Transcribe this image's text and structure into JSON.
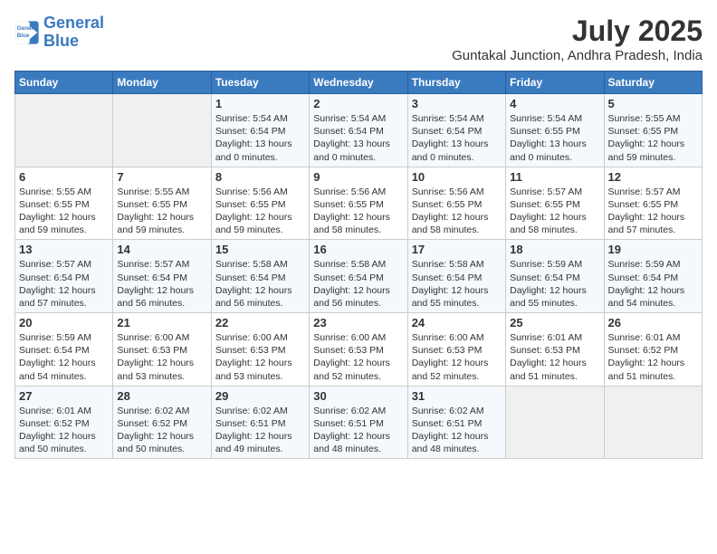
{
  "logo": {
    "line1": "General",
    "line2": "Blue"
  },
  "title": "July 2025",
  "subtitle": "Guntakal Junction, Andhra Pradesh, India",
  "days_of_week": [
    "Sunday",
    "Monday",
    "Tuesday",
    "Wednesday",
    "Thursday",
    "Friday",
    "Saturday"
  ],
  "weeks": [
    [
      {
        "day": "",
        "info": ""
      },
      {
        "day": "",
        "info": ""
      },
      {
        "day": "1",
        "info": "Sunrise: 5:54 AM\nSunset: 6:54 PM\nDaylight: 13 hours\nand 0 minutes."
      },
      {
        "day": "2",
        "info": "Sunrise: 5:54 AM\nSunset: 6:54 PM\nDaylight: 13 hours\nand 0 minutes."
      },
      {
        "day": "3",
        "info": "Sunrise: 5:54 AM\nSunset: 6:54 PM\nDaylight: 13 hours\nand 0 minutes."
      },
      {
        "day": "4",
        "info": "Sunrise: 5:54 AM\nSunset: 6:55 PM\nDaylight: 13 hours\nand 0 minutes."
      },
      {
        "day": "5",
        "info": "Sunrise: 5:55 AM\nSunset: 6:55 PM\nDaylight: 12 hours\nand 59 minutes."
      }
    ],
    [
      {
        "day": "6",
        "info": "Sunrise: 5:55 AM\nSunset: 6:55 PM\nDaylight: 12 hours\nand 59 minutes."
      },
      {
        "day": "7",
        "info": "Sunrise: 5:55 AM\nSunset: 6:55 PM\nDaylight: 12 hours\nand 59 minutes."
      },
      {
        "day": "8",
        "info": "Sunrise: 5:56 AM\nSunset: 6:55 PM\nDaylight: 12 hours\nand 59 minutes."
      },
      {
        "day": "9",
        "info": "Sunrise: 5:56 AM\nSunset: 6:55 PM\nDaylight: 12 hours\nand 58 minutes."
      },
      {
        "day": "10",
        "info": "Sunrise: 5:56 AM\nSunset: 6:55 PM\nDaylight: 12 hours\nand 58 minutes."
      },
      {
        "day": "11",
        "info": "Sunrise: 5:57 AM\nSunset: 6:55 PM\nDaylight: 12 hours\nand 58 minutes."
      },
      {
        "day": "12",
        "info": "Sunrise: 5:57 AM\nSunset: 6:55 PM\nDaylight: 12 hours\nand 57 minutes."
      }
    ],
    [
      {
        "day": "13",
        "info": "Sunrise: 5:57 AM\nSunset: 6:54 PM\nDaylight: 12 hours\nand 57 minutes."
      },
      {
        "day": "14",
        "info": "Sunrise: 5:57 AM\nSunset: 6:54 PM\nDaylight: 12 hours\nand 56 minutes."
      },
      {
        "day": "15",
        "info": "Sunrise: 5:58 AM\nSunset: 6:54 PM\nDaylight: 12 hours\nand 56 minutes."
      },
      {
        "day": "16",
        "info": "Sunrise: 5:58 AM\nSunset: 6:54 PM\nDaylight: 12 hours\nand 56 minutes."
      },
      {
        "day": "17",
        "info": "Sunrise: 5:58 AM\nSunset: 6:54 PM\nDaylight: 12 hours\nand 55 minutes."
      },
      {
        "day": "18",
        "info": "Sunrise: 5:59 AM\nSunset: 6:54 PM\nDaylight: 12 hours\nand 55 minutes."
      },
      {
        "day": "19",
        "info": "Sunrise: 5:59 AM\nSunset: 6:54 PM\nDaylight: 12 hours\nand 54 minutes."
      }
    ],
    [
      {
        "day": "20",
        "info": "Sunrise: 5:59 AM\nSunset: 6:54 PM\nDaylight: 12 hours\nand 54 minutes."
      },
      {
        "day": "21",
        "info": "Sunrise: 6:00 AM\nSunset: 6:53 PM\nDaylight: 12 hours\nand 53 minutes."
      },
      {
        "day": "22",
        "info": "Sunrise: 6:00 AM\nSunset: 6:53 PM\nDaylight: 12 hours\nand 53 minutes."
      },
      {
        "day": "23",
        "info": "Sunrise: 6:00 AM\nSunset: 6:53 PM\nDaylight: 12 hours\nand 52 minutes."
      },
      {
        "day": "24",
        "info": "Sunrise: 6:00 AM\nSunset: 6:53 PM\nDaylight: 12 hours\nand 52 minutes."
      },
      {
        "day": "25",
        "info": "Sunrise: 6:01 AM\nSunset: 6:53 PM\nDaylight: 12 hours\nand 51 minutes."
      },
      {
        "day": "26",
        "info": "Sunrise: 6:01 AM\nSunset: 6:52 PM\nDaylight: 12 hours\nand 51 minutes."
      }
    ],
    [
      {
        "day": "27",
        "info": "Sunrise: 6:01 AM\nSunset: 6:52 PM\nDaylight: 12 hours\nand 50 minutes."
      },
      {
        "day": "28",
        "info": "Sunrise: 6:02 AM\nSunset: 6:52 PM\nDaylight: 12 hours\nand 50 minutes."
      },
      {
        "day": "29",
        "info": "Sunrise: 6:02 AM\nSunset: 6:51 PM\nDaylight: 12 hours\nand 49 minutes."
      },
      {
        "day": "30",
        "info": "Sunrise: 6:02 AM\nSunset: 6:51 PM\nDaylight: 12 hours\nand 48 minutes."
      },
      {
        "day": "31",
        "info": "Sunrise: 6:02 AM\nSunset: 6:51 PM\nDaylight: 12 hours\nand 48 minutes."
      },
      {
        "day": "",
        "info": ""
      },
      {
        "day": "",
        "info": ""
      }
    ]
  ]
}
